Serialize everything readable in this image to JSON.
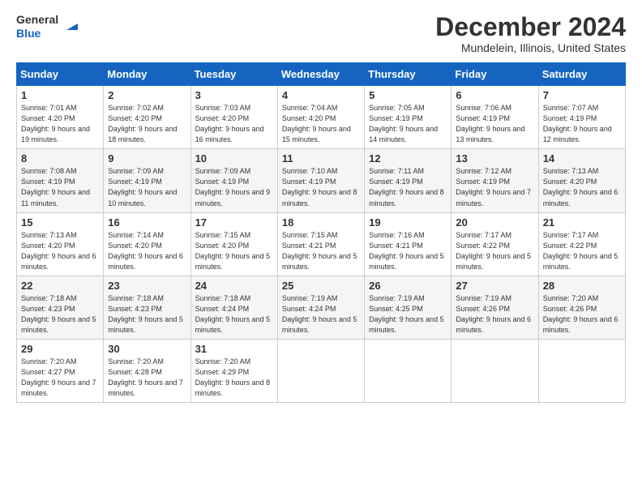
{
  "header": {
    "logo_general": "General",
    "logo_blue": "Blue",
    "month_title": "December 2024",
    "location": "Mundelein, Illinois, United States"
  },
  "days_of_week": [
    "Sunday",
    "Monday",
    "Tuesday",
    "Wednesday",
    "Thursday",
    "Friday",
    "Saturday"
  ],
  "weeks": [
    [
      {
        "day": "1",
        "sunrise": "7:01 AM",
        "sunset": "4:20 PM",
        "daylight": "9 hours and 19 minutes."
      },
      {
        "day": "2",
        "sunrise": "7:02 AM",
        "sunset": "4:20 PM",
        "daylight": "9 hours and 18 minutes."
      },
      {
        "day": "3",
        "sunrise": "7:03 AM",
        "sunset": "4:20 PM",
        "daylight": "9 hours and 16 minutes."
      },
      {
        "day": "4",
        "sunrise": "7:04 AM",
        "sunset": "4:20 PM",
        "daylight": "9 hours and 15 minutes."
      },
      {
        "day": "5",
        "sunrise": "7:05 AM",
        "sunset": "4:19 PM",
        "daylight": "9 hours and 14 minutes."
      },
      {
        "day": "6",
        "sunrise": "7:06 AM",
        "sunset": "4:19 PM",
        "daylight": "9 hours and 13 minutes."
      },
      {
        "day": "7",
        "sunrise": "7:07 AM",
        "sunset": "4:19 PM",
        "daylight": "9 hours and 12 minutes."
      }
    ],
    [
      {
        "day": "8",
        "sunrise": "7:08 AM",
        "sunset": "4:19 PM",
        "daylight": "9 hours and 11 minutes."
      },
      {
        "day": "9",
        "sunrise": "7:09 AM",
        "sunset": "4:19 PM",
        "daylight": "9 hours and 10 minutes."
      },
      {
        "day": "10",
        "sunrise": "7:09 AM",
        "sunset": "4:19 PM",
        "daylight": "9 hours and 9 minutes."
      },
      {
        "day": "11",
        "sunrise": "7:10 AM",
        "sunset": "4:19 PM",
        "daylight": "9 hours and 8 minutes."
      },
      {
        "day": "12",
        "sunrise": "7:11 AM",
        "sunset": "4:19 PM",
        "daylight": "9 hours and 8 minutes."
      },
      {
        "day": "13",
        "sunrise": "7:12 AM",
        "sunset": "4:19 PM",
        "daylight": "9 hours and 7 minutes."
      },
      {
        "day": "14",
        "sunrise": "7:13 AM",
        "sunset": "4:20 PM",
        "daylight": "9 hours and 6 minutes."
      }
    ],
    [
      {
        "day": "15",
        "sunrise": "7:13 AM",
        "sunset": "4:20 PM",
        "daylight": "9 hours and 6 minutes."
      },
      {
        "day": "16",
        "sunrise": "7:14 AM",
        "sunset": "4:20 PM",
        "daylight": "9 hours and 6 minutes."
      },
      {
        "day": "17",
        "sunrise": "7:15 AM",
        "sunset": "4:20 PM",
        "daylight": "9 hours and 5 minutes."
      },
      {
        "day": "18",
        "sunrise": "7:15 AM",
        "sunset": "4:21 PM",
        "daylight": "9 hours and 5 minutes."
      },
      {
        "day": "19",
        "sunrise": "7:16 AM",
        "sunset": "4:21 PM",
        "daylight": "9 hours and 5 minutes."
      },
      {
        "day": "20",
        "sunrise": "7:17 AM",
        "sunset": "4:22 PM",
        "daylight": "9 hours and 5 minutes."
      },
      {
        "day": "21",
        "sunrise": "7:17 AM",
        "sunset": "4:22 PM",
        "daylight": "9 hours and 5 minutes."
      }
    ],
    [
      {
        "day": "22",
        "sunrise": "7:18 AM",
        "sunset": "4:23 PM",
        "daylight": "9 hours and 5 minutes."
      },
      {
        "day": "23",
        "sunrise": "7:18 AM",
        "sunset": "4:23 PM",
        "daylight": "9 hours and 5 minutes."
      },
      {
        "day": "24",
        "sunrise": "7:18 AM",
        "sunset": "4:24 PM",
        "daylight": "9 hours and 5 minutes."
      },
      {
        "day": "25",
        "sunrise": "7:19 AM",
        "sunset": "4:24 PM",
        "daylight": "9 hours and 5 minutes."
      },
      {
        "day": "26",
        "sunrise": "7:19 AM",
        "sunset": "4:25 PM",
        "daylight": "9 hours and 5 minutes."
      },
      {
        "day": "27",
        "sunrise": "7:19 AM",
        "sunset": "4:26 PM",
        "daylight": "9 hours and 6 minutes."
      },
      {
        "day": "28",
        "sunrise": "7:20 AM",
        "sunset": "4:26 PM",
        "daylight": "9 hours and 6 minutes."
      }
    ],
    [
      {
        "day": "29",
        "sunrise": "7:20 AM",
        "sunset": "4:27 PM",
        "daylight": "9 hours and 7 minutes."
      },
      {
        "day": "30",
        "sunrise": "7:20 AM",
        "sunset": "4:28 PM",
        "daylight": "9 hours and 7 minutes."
      },
      {
        "day": "31",
        "sunrise": "7:20 AM",
        "sunset": "4:29 PM",
        "daylight": "9 hours and 8 minutes."
      },
      null,
      null,
      null,
      null
    ]
  ],
  "labels": {
    "sunrise": "Sunrise:",
    "sunset": "Sunset:",
    "daylight": "Daylight:"
  }
}
